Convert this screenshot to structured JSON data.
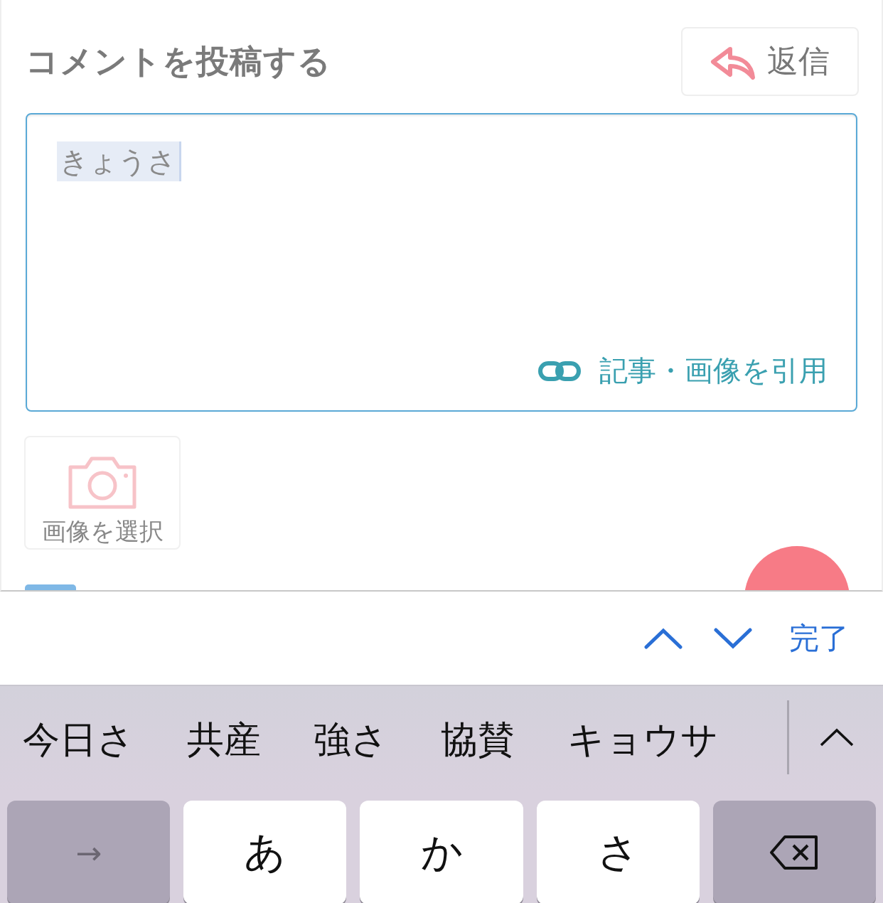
{
  "comment_form": {
    "title": "コメントを投稿する",
    "reply_button": "返信",
    "field": {
      "value": "きょうさ",
      "composing": true
    },
    "quote_link": "記事・画像を引用",
    "image_button": "画像を選択"
  },
  "input_toolbar": {
    "done": "完了"
  },
  "candidates": [
    {
      "text": "今日さ"
    },
    {
      "text": "共産"
    },
    {
      "text": "強さ"
    },
    {
      "text": "協賛"
    },
    {
      "text": "キョウサ"
    }
  ],
  "keys": [
    {
      "kind": "action",
      "label": "→"
    },
    {
      "kind": "char",
      "label": "あ"
    },
    {
      "kind": "char",
      "label": "か"
    },
    {
      "kind": "char",
      "label": "さ"
    },
    {
      "kind": "delete"
    }
  ]
}
